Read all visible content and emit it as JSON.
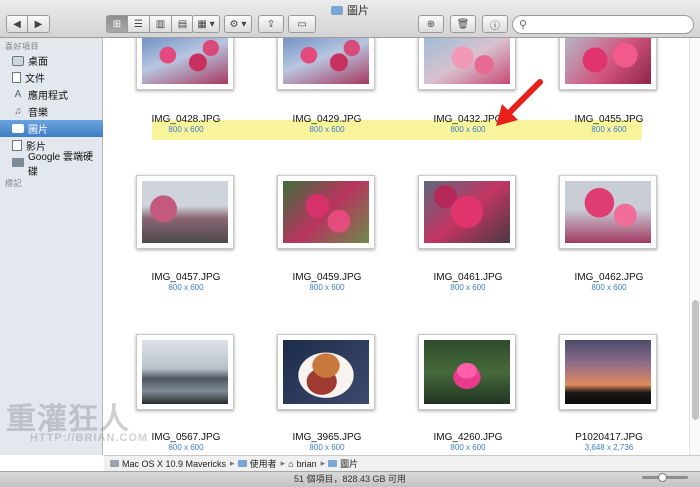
{
  "window": {
    "title": "圖片"
  },
  "toolbar": {
    "back": "◀",
    "forward": "▶",
    "view_icon": "⊞",
    "view_list": "☰",
    "view_columns": "▥",
    "view_cover": "▤",
    "arrange": "▦ ▾",
    "action": "⚙ ▾",
    "share": "⇪",
    "tag": "▭",
    "new_folder": "⊕",
    "trash": "🗑",
    "info": "ⓘ"
  },
  "search": {
    "placeholder": ""
  },
  "sidebar": {
    "favorites_heading": "喜好項目",
    "items": [
      {
        "label": "桌面",
        "icon": "desktop-icon"
      },
      {
        "label": "文件",
        "icon": "document-icon"
      },
      {
        "label": "應用程式",
        "icon": "applications-icon"
      },
      {
        "label": "音樂",
        "icon": "music-icon"
      },
      {
        "label": "圖片",
        "icon": "pictures-icon"
      },
      {
        "label": "影片",
        "icon": "movies-icon"
      },
      {
        "label": "Google 雲端硬碟",
        "icon": "folder-icon"
      }
    ],
    "selected": "圖片",
    "tags_heading": "標記"
  },
  "files": [
    {
      "name": "IMG_0428.JPG",
      "dims": "800 x 600"
    },
    {
      "name": "IMG_0429.JPG",
      "dims": "800 x 600"
    },
    {
      "name": "IMG_0432.JPG",
      "dims": "800 x 600"
    },
    {
      "name": "IMG_0455.JPG",
      "dims": "800 x 600"
    },
    {
      "name": "IMG_0457.JPG",
      "dims": "800 x 600"
    },
    {
      "name": "IMG_0459.JPG",
      "dims": "800 x 600"
    },
    {
      "name": "IMG_0461.JPG",
      "dims": "800 x 600"
    },
    {
      "name": "IMG_0462.JPG",
      "dims": "800 x 600"
    },
    {
      "name": "IMG_0567.JPG",
      "dims": "800 x 600"
    },
    {
      "name": "IMG_3965.JPG",
      "dims": "800 x 600"
    },
    {
      "name": "IMG_4260.JPG",
      "dims": "800 x 600"
    },
    {
      "name": "P1020417.JPG",
      "dims": "3,648 x 2,736"
    }
  ],
  "path": [
    "Mac OS X 10.9 Mavericks",
    "使用者",
    "brian",
    "圖片"
  ],
  "status": {
    "text": "51 個項目，828.43 GB 可用"
  },
  "watermark": {
    "title": "重灌狂人",
    "url": "HTTP://BRIAN.COM"
  },
  "colors": {
    "selection": "#3f7ec4",
    "highlight": "#f7f49c",
    "arrow": "#e8201a",
    "dims": "#3d7fc8"
  }
}
